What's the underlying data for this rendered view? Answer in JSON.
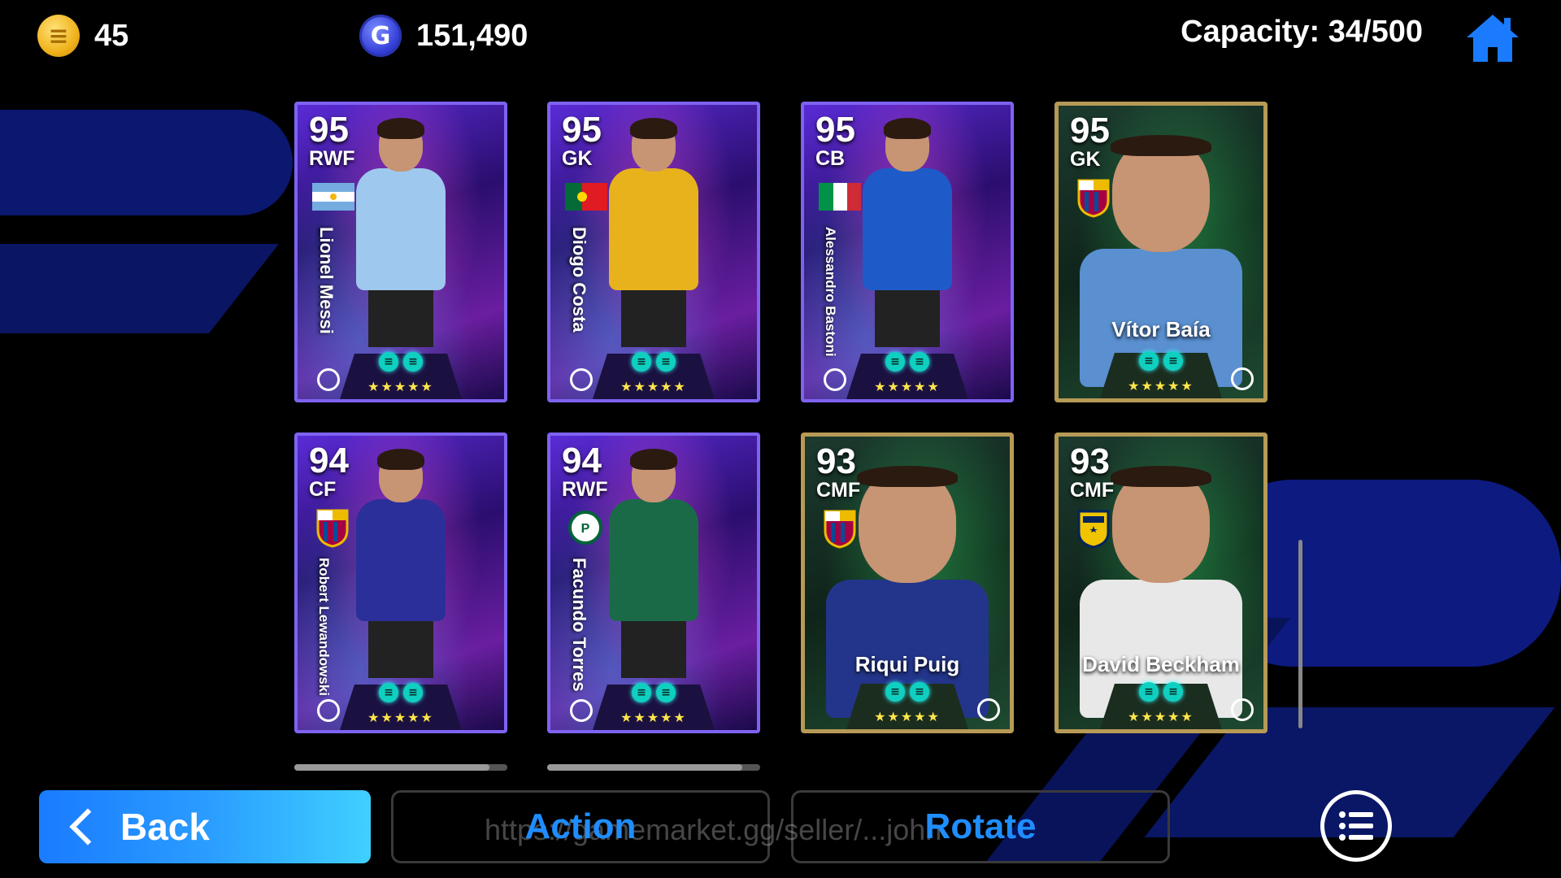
{
  "header": {
    "coins": "45",
    "gp": "151,490",
    "capacity": "Capacity: 34/500"
  },
  "cards": [
    {
      "rating": "95",
      "position": "RWF",
      "name": "Lionel Messi",
      "style": "purple",
      "emblem": "argentina-flag",
      "kit": "#9ec8ee"
    },
    {
      "rating": "95",
      "position": "GK",
      "name": "Diogo Costa",
      "style": "purple",
      "emblem": "portugal-flag",
      "kit": "#e8b21c"
    },
    {
      "rating": "95",
      "position": "CB",
      "name": "Alessandro Bastoni",
      "style": "purple",
      "emblem": "italy-flag",
      "kit": "#1e5ac8"
    },
    {
      "rating": "95",
      "position": "GK",
      "name": "Vítor Baía",
      "style": "gold",
      "emblem": "barcelona-crest",
      "kit": "#5a8fd0"
    },
    {
      "rating": "94",
      "position": "CF",
      "name": "Robert Lewandowski",
      "style": "purple",
      "emblem": "barcelona-crest",
      "kit": "#2a2f9a"
    },
    {
      "rating": "94",
      "position": "RWF",
      "name": "Facundo Torres",
      "style": "purple",
      "emblem": "palmeiras-crest",
      "kit": "#1a6a48"
    },
    {
      "rating": "93",
      "position": "CMF",
      "name": "Riqui Puig",
      "style": "gold",
      "emblem": "barcelona-crest",
      "kit": "#23358a"
    },
    {
      "rating": "93",
      "position": "CMF",
      "name": "David Beckham",
      "style": "gold",
      "emblem": "la-galaxy-crest",
      "kit": "#e8e8e8"
    }
  ],
  "stars": "★★★★★",
  "buttons": {
    "back": "Back",
    "action": "Action",
    "rotate": "Rotate"
  },
  "watermark": "https://gamemarket.gg/seller/...john",
  "colors": {
    "back_gradient_start": "#1a7bff",
    "back_gradient_end": "#3fd0ff",
    "outline_label": "#1f8dff"
  }
}
